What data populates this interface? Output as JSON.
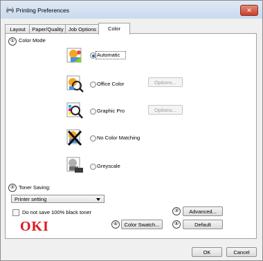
{
  "window": {
    "title": "Printing Preferences",
    "close_icon": "✕"
  },
  "tabs": [
    {
      "label": "Layout"
    },
    {
      "label": "Paper/Quality"
    },
    {
      "label": "Job Options"
    },
    {
      "label": "Color",
      "active": true
    }
  ],
  "color_mode": {
    "number": "①",
    "heading": "Color Mode",
    "options": [
      {
        "label": "Automatic",
        "selected": true,
        "icon": "automatic-color-icon"
      },
      {
        "label": "Office Color",
        "selected": false,
        "icon": "office-color-icon",
        "options_button": "Options..."
      },
      {
        "label": "Graphic Pro",
        "selected": false,
        "icon": "graphic-pro-icon",
        "options_button": "Options..."
      },
      {
        "label": "No Color Matching",
        "selected": false,
        "icon": "no-color-matching-icon"
      },
      {
        "label": "Greyscale",
        "selected": false,
        "icon": "greyscale-icon"
      }
    ]
  },
  "toner_saving": {
    "number": "②",
    "label": "Toner Saving:",
    "value": "Printer setting",
    "checkbox_label": "Do not save 100% black toner",
    "checked": false
  },
  "advanced": {
    "number": "③",
    "label": "Advanced..."
  },
  "swatch": {
    "number": "④",
    "label": "Color Swatch..."
  },
  "default": {
    "number": "⑤",
    "label": "Default"
  },
  "brand": {
    "logo": "OKI"
  },
  "footer": {
    "ok": "OK",
    "cancel": "Cancel"
  },
  "colors": {
    "brand_red": "#e0161f",
    "selection_blue": "#2b5fa8",
    "close_red": "#c7402c"
  }
}
